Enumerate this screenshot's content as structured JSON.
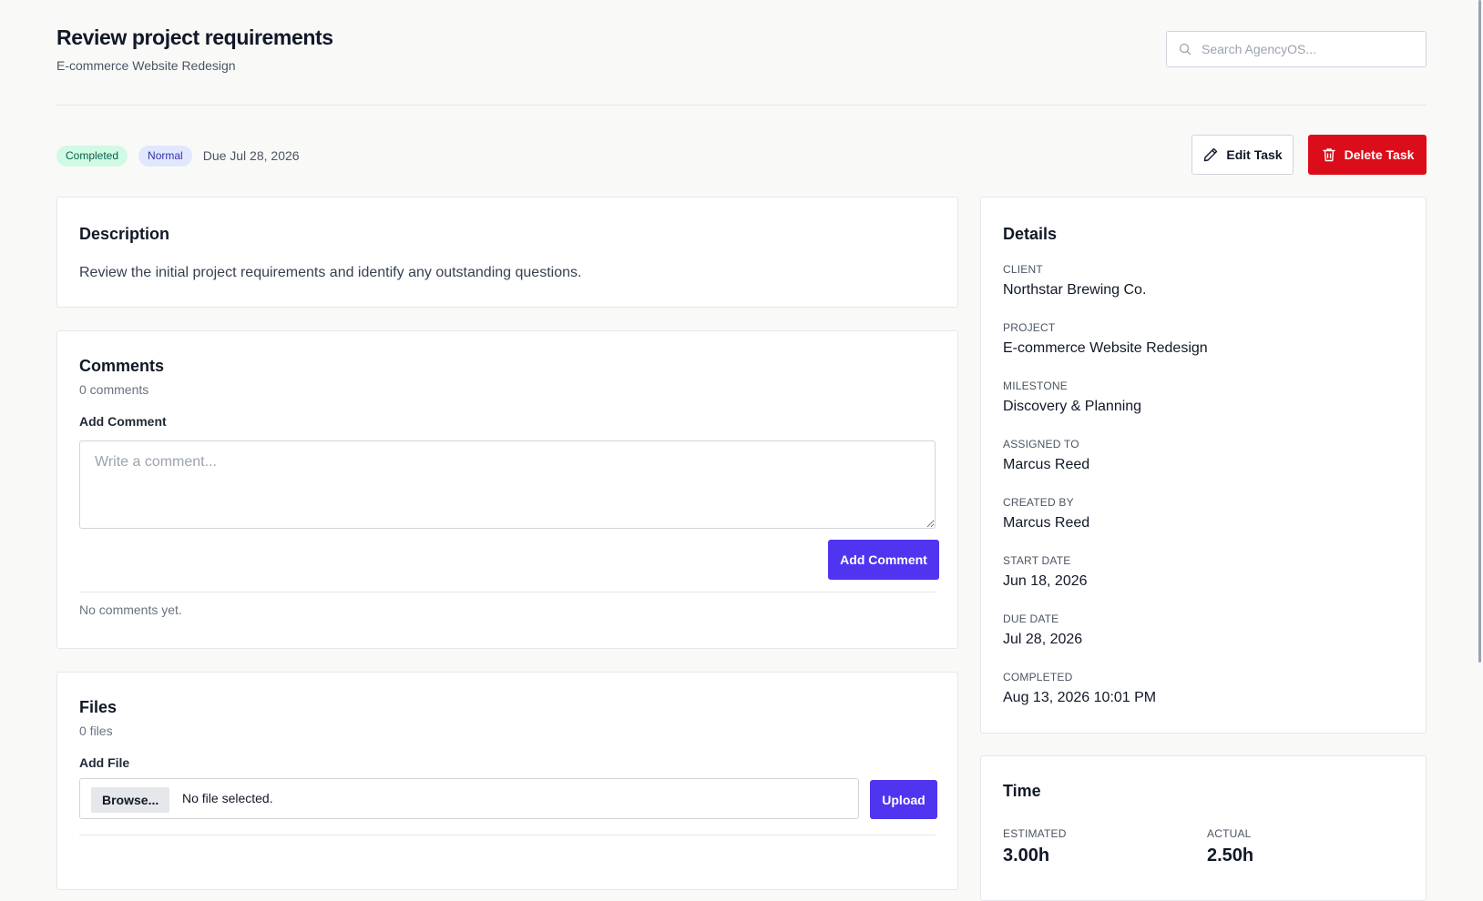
{
  "header": {
    "title": "Review project requirements",
    "subtitle": "E-commerce Website Redesign",
    "search_placeholder": "Search AgencyOS..."
  },
  "task": {
    "status_badge": "Completed",
    "priority_badge": "Normal",
    "due": "Due Jul 28, 2026",
    "edit_label": "Edit Task",
    "delete_label": "Delete Task"
  },
  "description": {
    "title": "Description",
    "text": "Review the initial project requirements and identify any outstanding questions."
  },
  "comments": {
    "title": "Comments",
    "count": "0 comments",
    "add_label": "Add Comment",
    "placeholder": "Write a comment...",
    "button_label": "Add Comment",
    "empty_text": "No comments yet."
  },
  "files": {
    "title": "Files",
    "count": "0 files",
    "add_label": "Add File",
    "browse_label": "Browse...",
    "no_file": "No file selected.",
    "upload_label": "Upload"
  },
  "details": {
    "title": "Details",
    "fields": [
      {
        "label": "CLIENT",
        "value": "Northstar Brewing Co."
      },
      {
        "label": "PROJECT",
        "value": "E-commerce Website Redesign"
      },
      {
        "label": "MILESTONE",
        "value": "Discovery & Planning"
      },
      {
        "label": "ASSIGNED TO",
        "value": "Marcus Reed"
      },
      {
        "label": "CREATED BY",
        "value": "Marcus Reed"
      },
      {
        "label": "START DATE",
        "value": "Jun 18, 2026"
      },
      {
        "label": "DUE DATE",
        "value": "Jul 28, 2026"
      },
      {
        "label": "COMPLETED",
        "value": "Aug 13, 2026 10:01 PM"
      }
    ]
  },
  "time": {
    "title": "Time",
    "estimated_label": "ESTIMATED",
    "estimated_value": "3.00h",
    "actual_label": "ACTUAL",
    "actual_value": "2.50h"
  },
  "colors": {
    "primary": "#4f35f0",
    "danger": "#dc0d1a",
    "completed_bg": "#d1fae5",
    "normal_bg": "#e0e7ff"
  },
  "icons": {
    "search": "search-icon",
    "edit": "pencil-icon",
    "delete": "trash-icon"
  }
}
